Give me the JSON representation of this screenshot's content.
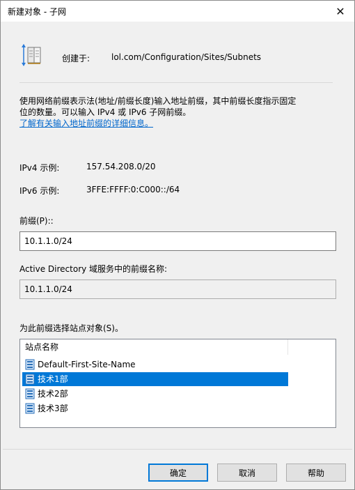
{
  "window": {
    "title": "新建对象 - 子网",
    "close_glyph": "✕"
  },
  "header": {
    "created_label": "创建于:",
    "created_path": "lol.com/Configuration/Sites/Subnets"
  },
  "description": {
    "text_line1": "使用网络前缀表示法(地址/前缀长度)输入地址前缀，其中前缀长度指示固定",
    "text_line2": "位的数量。可以输入 IPv4 或 IPv6 子网前缀。",
    "link": "了解有关输入地址前缀的详细信息。"
  },
  "examples": {
    "ipv4_label": "IPv4 示例:",
    "ipv4_value": "157.54.208.0/20",
    "ipv6_label": "IPv6 示例:",
    "ipv6_value": "3FFE:FFFF:0:C000::/64"
  },
  "prefix": {
    "label": "前缀(P)::",
    "value": "10.1.1.0/24"
  },
  "ad_name": {
    "label": "Active Directory 域服务中的前缀名称:",
    "value": "10.1.1.0/24"
  },
  "site": {
    "label": "为此前缀选择站点对象(S)。",
    "column_header": "站点名称",
    "items": [
      {
        "label": "Default-First-Site-Name",
        "selected": false
      },
      {
        "label": "技术1部",
        "selected": true
      },
      {
        "label": "技术2部",
        "selected": false
      },
      {
        "label": "技术3部",
        "selected": false
      }
    ]
  },
  "buttons": {
    "ok": "确定",
    "cancel": "取消",
    "help": "帮助"
  },
  "icons": {
    "header": "subnet-book-icon",
    "site": "site-object-icon"
  },
  "colors": {
    "selection": "#0078d7",
    "link": "#0066cc",
    "default_button_border": "#0078d7"
  }
}
